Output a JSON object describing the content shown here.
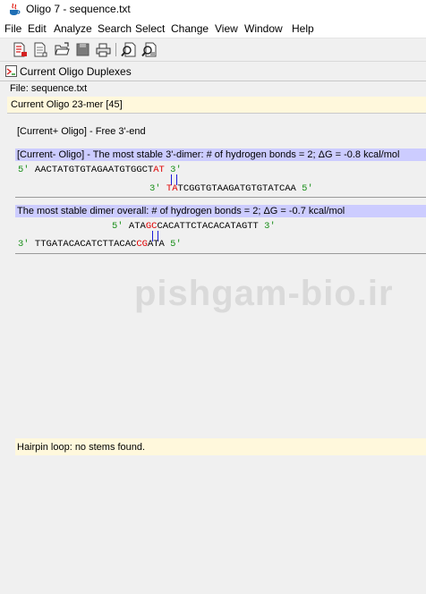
{
  "window": {
    "title": "Oligo 7 - sequence.txt",
    "app_icon": "java-cup-icon"
  },
  "menu": [
    "File",
    "Edit",
    "Analyze",
    "Search",
    "Select",
    "Change",
    "View",
    "Window",
    "Help"
  ],
  "toolbar": {
    "icons": [
      "oligo-list-icon",
      "document-icon",
      "open-folder-icon",
      "save-disk-icon",
      "printer-icon",
      "search-icon",
      "search-replace-icon"
    ]
  },
  "panel": {
    "title": "Current Oligo Duplexes",
    "icon": "duplex-window-icon"
  },
  "file_label": "File: sequence.txt",
  "current_oligo": "Current Oligo 23-mer [45]",
  "free_end": "[Current+ Oligo] - Free 3'-end",
  "dimer3": {
    "header": "[Current- Oligo] - The most stable 3'-dimer: # of hydrogen bonds = 2; ΔG = -0.8 kcal/mol",
    "top": {
      "prime5": "5'",
      "seq": "AACTATGTGTAGAATGTGGCT",
      "pair": "AT",
      "prime3": "3'"
    },
    "bottom": {
      "prime3": "3'",
      "pair": "TA",
      "seq": "TCGGTGTAAGATGTGTATCAA",
      "prime5": "5'"
    }
  },
  "dimer_all": {
    "header": "The most stable dimer overall: # of hydrogen bonds = 2; ΔG = -0.7 kcal/mol",
    "top": {
      "prime5": "5'",
      "pre": "ATA",
      "pair": "GC",
      "post": "CACATTCTACACATAGTT",
      "prime3": "3'"
    },
    "bottom": {
      "prime3": "3'",
      "pre": "TTGATACACATCTTACAC",
      "pair": "CG",
      "post": "ATA",
      "prime5": "5'"
    }
  },
  "watermark": "pishgam-bio.ir",
  "hairpin": "Hairpin loop: no stems found."
}
